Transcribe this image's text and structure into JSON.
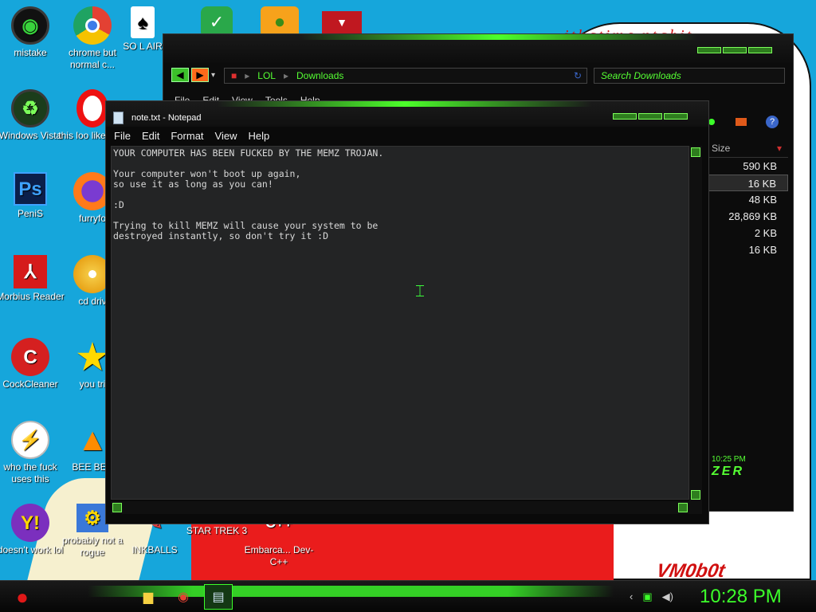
{
  "wallpaper": {
    "scribble": "ithatimc.ntabit",
    "signature": "VM0b0t"
  },
  "desktop_icons": [
    {
      "label": "mistake",
      "icon": "mistake-icon",
      "color": "#1a1a1a"
    },
    {
      "label": "chrome but normal c...",
      "icon": "chrome-icon",
      "color": "#e34133"
    },
    {
      "label": "SO L AIR",
      "icon": "solitaire-icon",
      "color": "#ffffff"
    },
    {
      "label": "Windows Vista",
      "icon": "recycle-bin-icon",
      "color": "#2a6b2a"
    },
    {
      "label": "this loo like a va",
      "icon": "opera-icon",
      "color": "#e11"
    },
    {
      "label": "PeniS",
      "icon": "photoshop-icon",
      "color": "#0b3b8c"
    },
    {
      "label": "furryfo",
      "icon": "firefox-icon",
      "color": "#ff7a1a"
    },
    {
      "label": "Morbius Reader",
      "icon": "pdf-reader-icon",
      "color": "#d51b1b"
    },
    {
      "label": "cd driv",
      "icon": "cd-icon",
      "color": "#f4c842"
    },
    {
      "label": "CockCleaner",
      "icon": "ccleaner-icon",
      "color": "#d52020"
    },
    {
      "label": "you tri",
      "icon": "star-icon",
      "color": "#ffd900"
    },
    {
      "label": "who the fuck uses this",
      "icon": "winamp-icon",
      "color": "#ff6a00"
    },
    {
      "label": "BEE BEE",
      "icon": "vlc-icon",
      "color": "#ff8c00"
    },
    {
      "label": "doesn't work lol",
      "icon": "yahoo-messenger-icon",
      "color": "#7b2fbe"
    },
    {
      "label": "probably not a rogue",
      "icon": "settings-icon",
      "color": "#3a78d8"
    },
    {
      "label": "INKBALLS",
      "icon": "inkball-icon",
      "color": "#e04040"
    },
    {
      "label": "STAR TREK 3",
      "icon": "star-wars-icon",
      "color": "#8a1f1f"
    },
    {
      "label": "Embarca... Dev-C++",
      "icon": "devcpp-icon",
      "color": "#ffffff"
    }
  ],
  "explorer": {
    "breadcrumb": [
      "LOL",
      "Downloads"
    ],
    "search_placeholder": "Search Downloads",
    "menu": [
      "File",
      "Edit",
      "View",
      "Tools",
      "Help"
    ],
    "column_header": "Size",
    "sizes": [
      "590 KB",
      "16 KB",
      "48 KB",
      "28,869 KB",
      "2 KB",
      "16 KB"
    ],
    "clock": "10:25 PM",
    "logo_text": "ZER"
  },
  "notepad": {
    "title": "note.txt - Notepad",
    "menu": [
      "File",
      "Edit",
      "Format",
      "View",
      "Help"
    ],
    "content": "YOUR COMPUTER HAS BEEN FUCKED BY THE MEMZ TROJAN.\n\nYour computer won't boot up again,\nso use it as long as you can!\n\n:D\n\nTrying to kill MEMZ will cause your system to be\ndestroyed instantly, so don't try it :D"
  },
  "taskbar": {
    "clock": "10:28 PM",
    "start_icon": "angry-bird-icon"
  }
}
